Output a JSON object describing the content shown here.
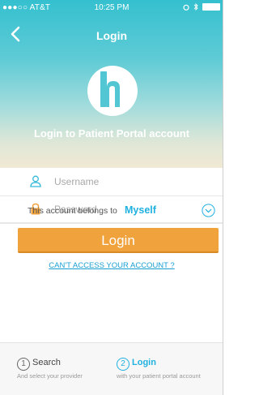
{
  "status_bar": {
    "carrier": "●●●○○ AT&T",
    "time": "10:25 PM"
  },
  "nav": {
    "title": "Login",
    "back_icon": "chevron-left-icon"
  },
  "hero": {
    "headline": "Login to Patient Portal account",
    "logo_icon": "h-logo-icon"
  },
  "form": {
    "username_placeholder": "Username",
    "password_placeholder": "Password",
    "belongs_label": "This account belongs to",
    "belongs_value": "Myself",
    "login_button": "Login",
    "cant_access": "CAN'T ACCESS YOUR ACCOUNT ?"
  },
  "steps": [
    {
      "number": "1",
      "name": "Search",
      "sub": "And select your provider"
    },
    {
      "number": "2",
      "name": "Login",
      "sub": "with your patient portal account"
    }
  ],
  "colors": {
    "accent": "#1fb1e0",
    "button": "#f0a23c",
    "hero_top": "#35c0cf"
  }
}
